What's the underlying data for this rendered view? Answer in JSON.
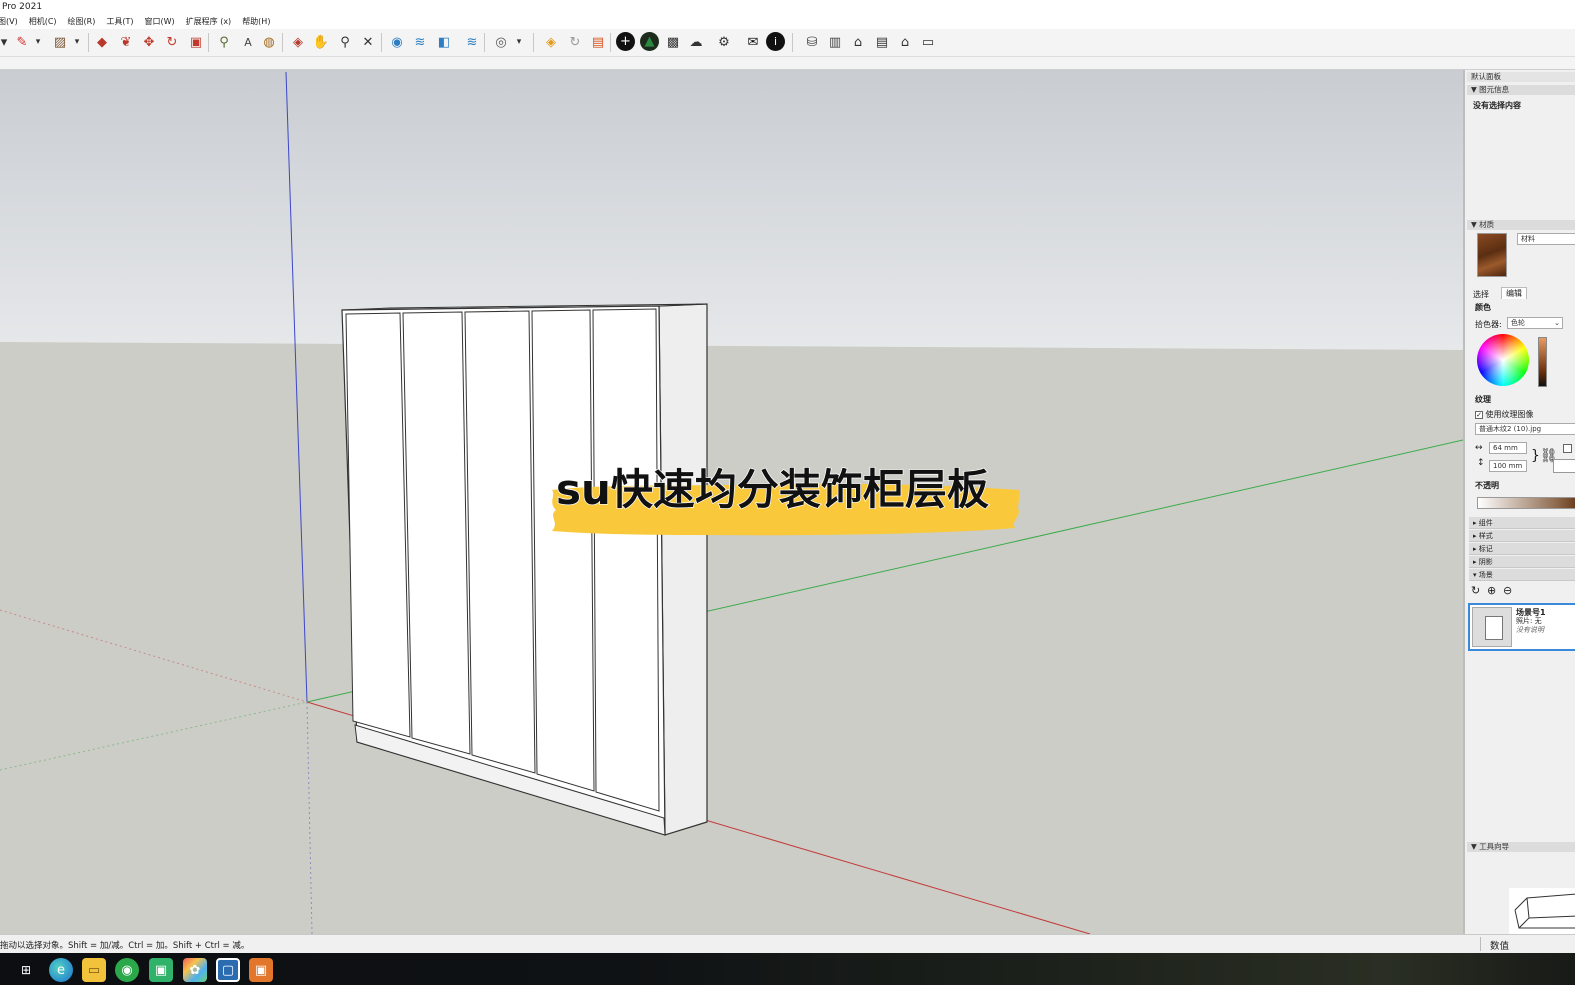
{
  "app": {
    "title": "Pro 2021"
  },
  "menu": [
    "图(V)",
    "相机(C)",
    "绘图(R)",
    "工具(T)",
    "窗口(W)",
    "扩展程序 (x)",
    "帮助(H)"
  ],
  "toolbar": {
    "icons": [
      "select-arrow-icon",
      "freehand-pencil-icon",
      "eraser-icon",
      "paint-bucket-icon",
      "push-pull-icon",
      "follow-me-icon",
      "move-icon",
      "rotate-icon",
      "scale-icon",
      "tape-measure-icon",
      "text-icon",
      "paint-icon",
      "section-plane-icon",
      "walk-icon",
      "zoom-icon",
      "zoom-extents-icon",
      "view-icon",
      "layers-icon",
      "materials-icon",
      "shadow-icon",
      "user-icon",
      "component-icon",
      "refresh-icon",
      "ruby-icon",
      "plus-circle-icon",
      "tree-icon",
      "checker-icon",
      "cloud-icon",
      "gear-icon",
      "mail-icon",
      "info-icon",
      "warehouse-icon",
      "book-icon",
      "home-icon",
      "box-icon",
      "house-outline-icon",
      "cabinet-icon"
    ]
  },
  "viewport": {
    "caption": "su快速均分装饰柜层板",
    "colors": {
      "sky_top": "#c9cdd2",
      "sky_bottom": "#e6e8ea",
      "ground": "#cdcdc7",
      "cabinet": "#ffffff",
      "caption_highlight": "#f9c93b",
      "red_axis": "#c23a3a",
      "green_axis": "#3bab4a",
      "blue_axis": "#3c46c8"
    }
  },
  "tray": {
    "title": "默认面板",
    "entity_info": {
      "header": "▼ 图元信息",
      "empty": "没有选择内容"
    },
    "materials": {
      "header": "▼ 材质",
      "name_field": "材料",
      "tabs": [
        "选择",
        "编辑"
      ],
      "color_label": "颜色",
      "picker_label": "拾色器:",
      "picker_value": "色轮",
      "texture_label": "纹理",
      "use_texture_label": "使用纹理图像",
      "texture_file": "普通木纹2 (10).jpg",
      "width_value": "64 mm",
      "height_value": "100 mm",
      "opacity_label": "不透明"
    },
    "collapsed_panels": [
      "▸ 组件",
      "▸ 样式",
      "▸ 标记",
      "▸ 阴影"
    ],
    "scenes": {
      "header": "▾ 场景",
      "scene_name": "场景号1",
      "scene_photo": "照片: 无",
      "scene_desc": "没有说明"
    },
    "instructor": {
      "header": "▼ 工具向导"
    }
  },
  "status": {
    "hint": "拖动以选择对象。Shift = 加/减。Ctrl = 加。Shift + Ctrl = 减。",
    "measure_label": "数值"
  },
  "taskbar": {
    "icons": [
      "taskview-icon",
      "edge-icon",
      "file-explorer-icon",
      "wechat-icon",
      "messages-icon",
      "photos-icon",
      "sketchup-icon",
      "recorder-icon"
    ]
  }
}
